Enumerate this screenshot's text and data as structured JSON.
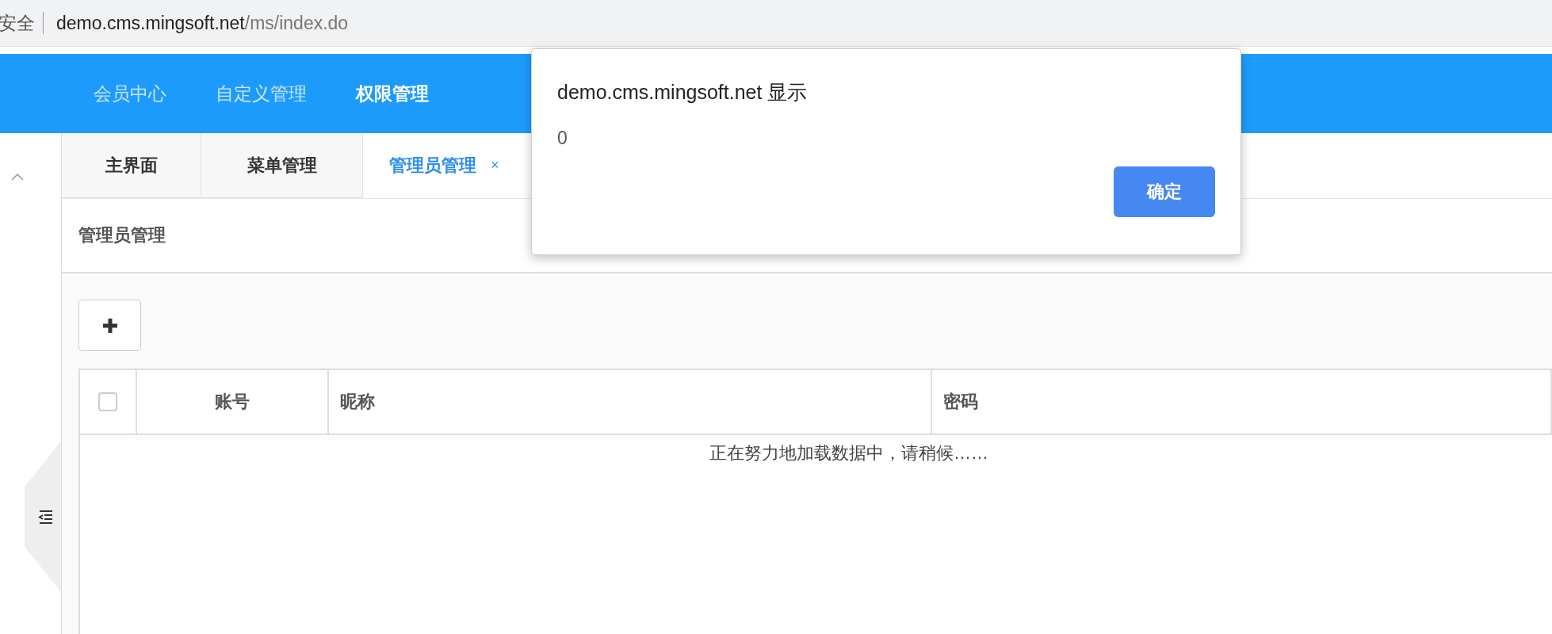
{
  "address_bar": {
    "security_label": "安全",
    "url_host": "demo.cms.mingsoft.net",
    "url_path": "/ms/index.do"
  },
  "nav": [
    {
      "label": "会员中心",
      "selected": false
    },
    {
      "label": "自定义管理",
      "selected": false
    },
    {
      "label": "权限管理",
      "selected": true
    }
  ],
  "tabs": [
    {
      "label": "主界面",
      "selected": false
    },
    {
      "label": "菜单管理",
      "selected": false
    },
    {
      "label": "管理员管理",
      "selected": true,
      "close_glyph": "×"
    }
  ],
  "page_title": "管理员管理",
  "table": {
    "select_all_checked": false,
    "columns": [
      {
        "label": "账号",
        "centered": true
      },
      {
        "label": "昵称",
        "centered": false
      },
      {
        "label": "密码",
        "centered": false
      }
    ],
    "loading_message": "正在努力地加载数据中，请稍候……"
  },
  "dialog": {
    "title": "demo.cms.mingsoft.net 显示",
    "message": "0",
    "buttons": [
      "确定"
    ]
  }
}
